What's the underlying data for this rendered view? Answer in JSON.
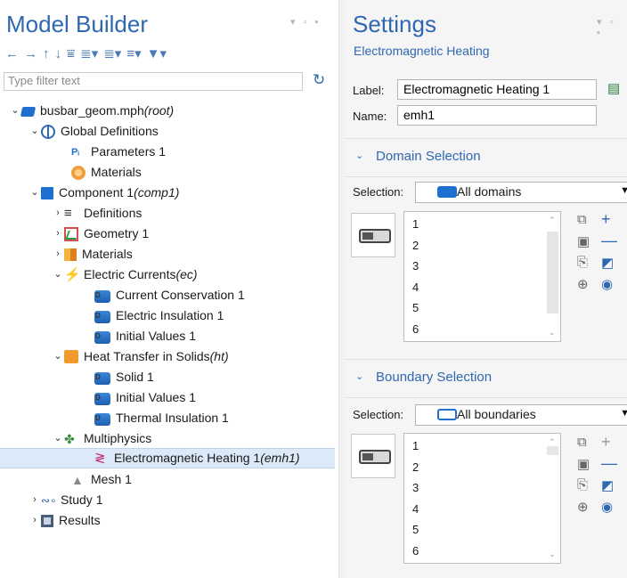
{
  "model_builder": {
    "title": "Model Builder",
    "panel_controls": "▾ ▫ ▪",
    "toolbar_icons": [
      "arrow-left-icon",
      "arrow-right-icon",
      "arrow-up-icon",
      "arrow-down-icon",
      "filter-icon",
      "expand-icon",
      "collapse-icon",
      "list-icon",
      "tag-icon"
    ],
    "filter_placeholder": "Type filter text",
    "tree": [
      {
        "label": "busbar_geom.mph",
        "suffix": " (root)"
      },
      {
        "label": "Global Definitions",
        "suffix": ""
      },
      {
        "label": "Parameters 1",
        "suffix": ""
      },
      {
        "label": "Materials",
        "suffix": ""
      },
      {
        "label": "Component 1",
        "suffix": " (comp1)"
      },
      {
        "label": "Definitions",
        "suffix": ""
      },
      {
        "label": "Geometry 1",
        "suffix": ""
      },
      {
        "label": "Materials",
        "suffix": ""
      },
      {
        "label": "Electric Currents",
        "suffix": " (ec)"
      },
      {
        "label": "Current Conservation 1",
        "suffix": ""
      },
      {
        "label": "Electric Insulation 1",
        "suffix": ""
      },
      {
        "label": "Initial Values 1",
        "suffix": ""
      },
      {
        "label": "Heat Transfer in Solids",
        "suffix": " (ht)"
      },
      {
        "label": "Solid 1",
        "suffix": ""
      },
      {
        "label": "Initial Values 1",
        "suffix": ""
      },
      {
        "label": "Thermal Insulation 1",
        "suffix": ""
      },
      {
        "label": "Multiphysics",
        "suffix": ""
      },
      {
        "label": "Electromagnetic Heating 1",
        "suffix": " (emh1)"
      },
      {
        "label": "Mesh 1",
        "suffix": ""
      },
      {
        "label": "Study 1",
        "suffix": ""
      },
      {
        "label": "Results",
        "suffix": ""
      }
    ]
  },
  "settings": {
    "title": "Settings",
    "subtitle": "Electromagnetic Heating",
    "panel_controls": "▾ ▫ ▪",
    "label_caption": "Label:",
    "label_value": "Electromagnetic Heating 1",
    "name_caption": "Name:",
    "name_value": "emh1",
    "domain_section": {
      "title": "Domain Selection",
      "selection_caption": "Selection:",
      "selection_value": "All domains",
      "items": [
        "1",
        "2",
        "3",
        "4",
        "5",
        "6"
      ]
    },
    "boundary_section": {
      "title": "Boundary Selection",
      "selection_caption": "Selection:",
      "selection_value": "All boundaries",
      "items": [
        "1",
        "2",
        "3",
        "4",
        "5",
        "6"
      ]
    }
  }
}
